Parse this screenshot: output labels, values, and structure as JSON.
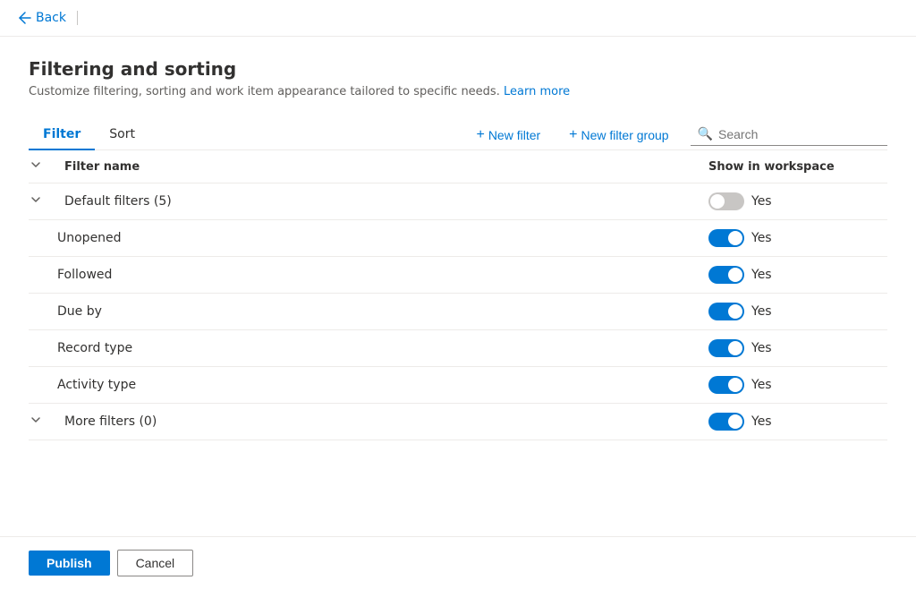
{
  "nav": {
    "back_label": "Back"
  },
  "page": {
    "title": "Filtering and sorting",
    "subtitle": "Customize filtering, sorting and work item appearance tailored to specific needs.",
    "learn_more": "Learn more"
  },
  "tabs": [
    {
      "id": "filter",
      "label": "Filter",
      "active": true
    },
    {
      "id": "sort",
      "label": "Sort",
      "active": false
    }
  ],
  "toolbar": {
    "new_filter_label": "New filter",
    "new_filter_group_label": "New filter group",
    "search_placeholder": "Search"
  },
  "table": {
    "col_name": "Filter name",
    "col_workspace": "Show in workspace",
    "rows": [
      {
        "id": "default-filters-group",
        "type": "group",
        "name": "Default filters (5)",
        "toggled": false,
        "toggle_label": "Yes",
        "expanded": true
      },
      {
        "id": "unopened",
        "type": "item",
        "name": "Unopened",
        "toggled": true,
        "toggle_label": "Yes"
      },
      {
        "id": "followed",
        "type": "item",
        "name": "Followed",
        "toggled": true,
        "toggle_label": "Yes"
      },
      {
        "id": "due-by",
        "type": "item",
        "name": "Due by",
        "toggled": true,
        "toggle_label": "Yes"
      },
      {
        "id": "record-type",
        "type": "item",
        "name": "Record type",
        "toggled": true,
        "toggle_label": "Yes"
      },
      {
        "id": "activity-type",
        "type": "item",
        "name": "Activity type",
        "toggled": true,
        "toggle_label": "Yes"
      },
      {
        "id": "more-filters-group",
        "type": "group",
        "name": "More filters (0)",
        "toggled": true,
        "toggle_label": "Yes",
        "expanded": true
      }
    ]
  },
  "footer": {
    "publish_label": "Publish",
    "cancel_label": "Cancel"
  }
}
